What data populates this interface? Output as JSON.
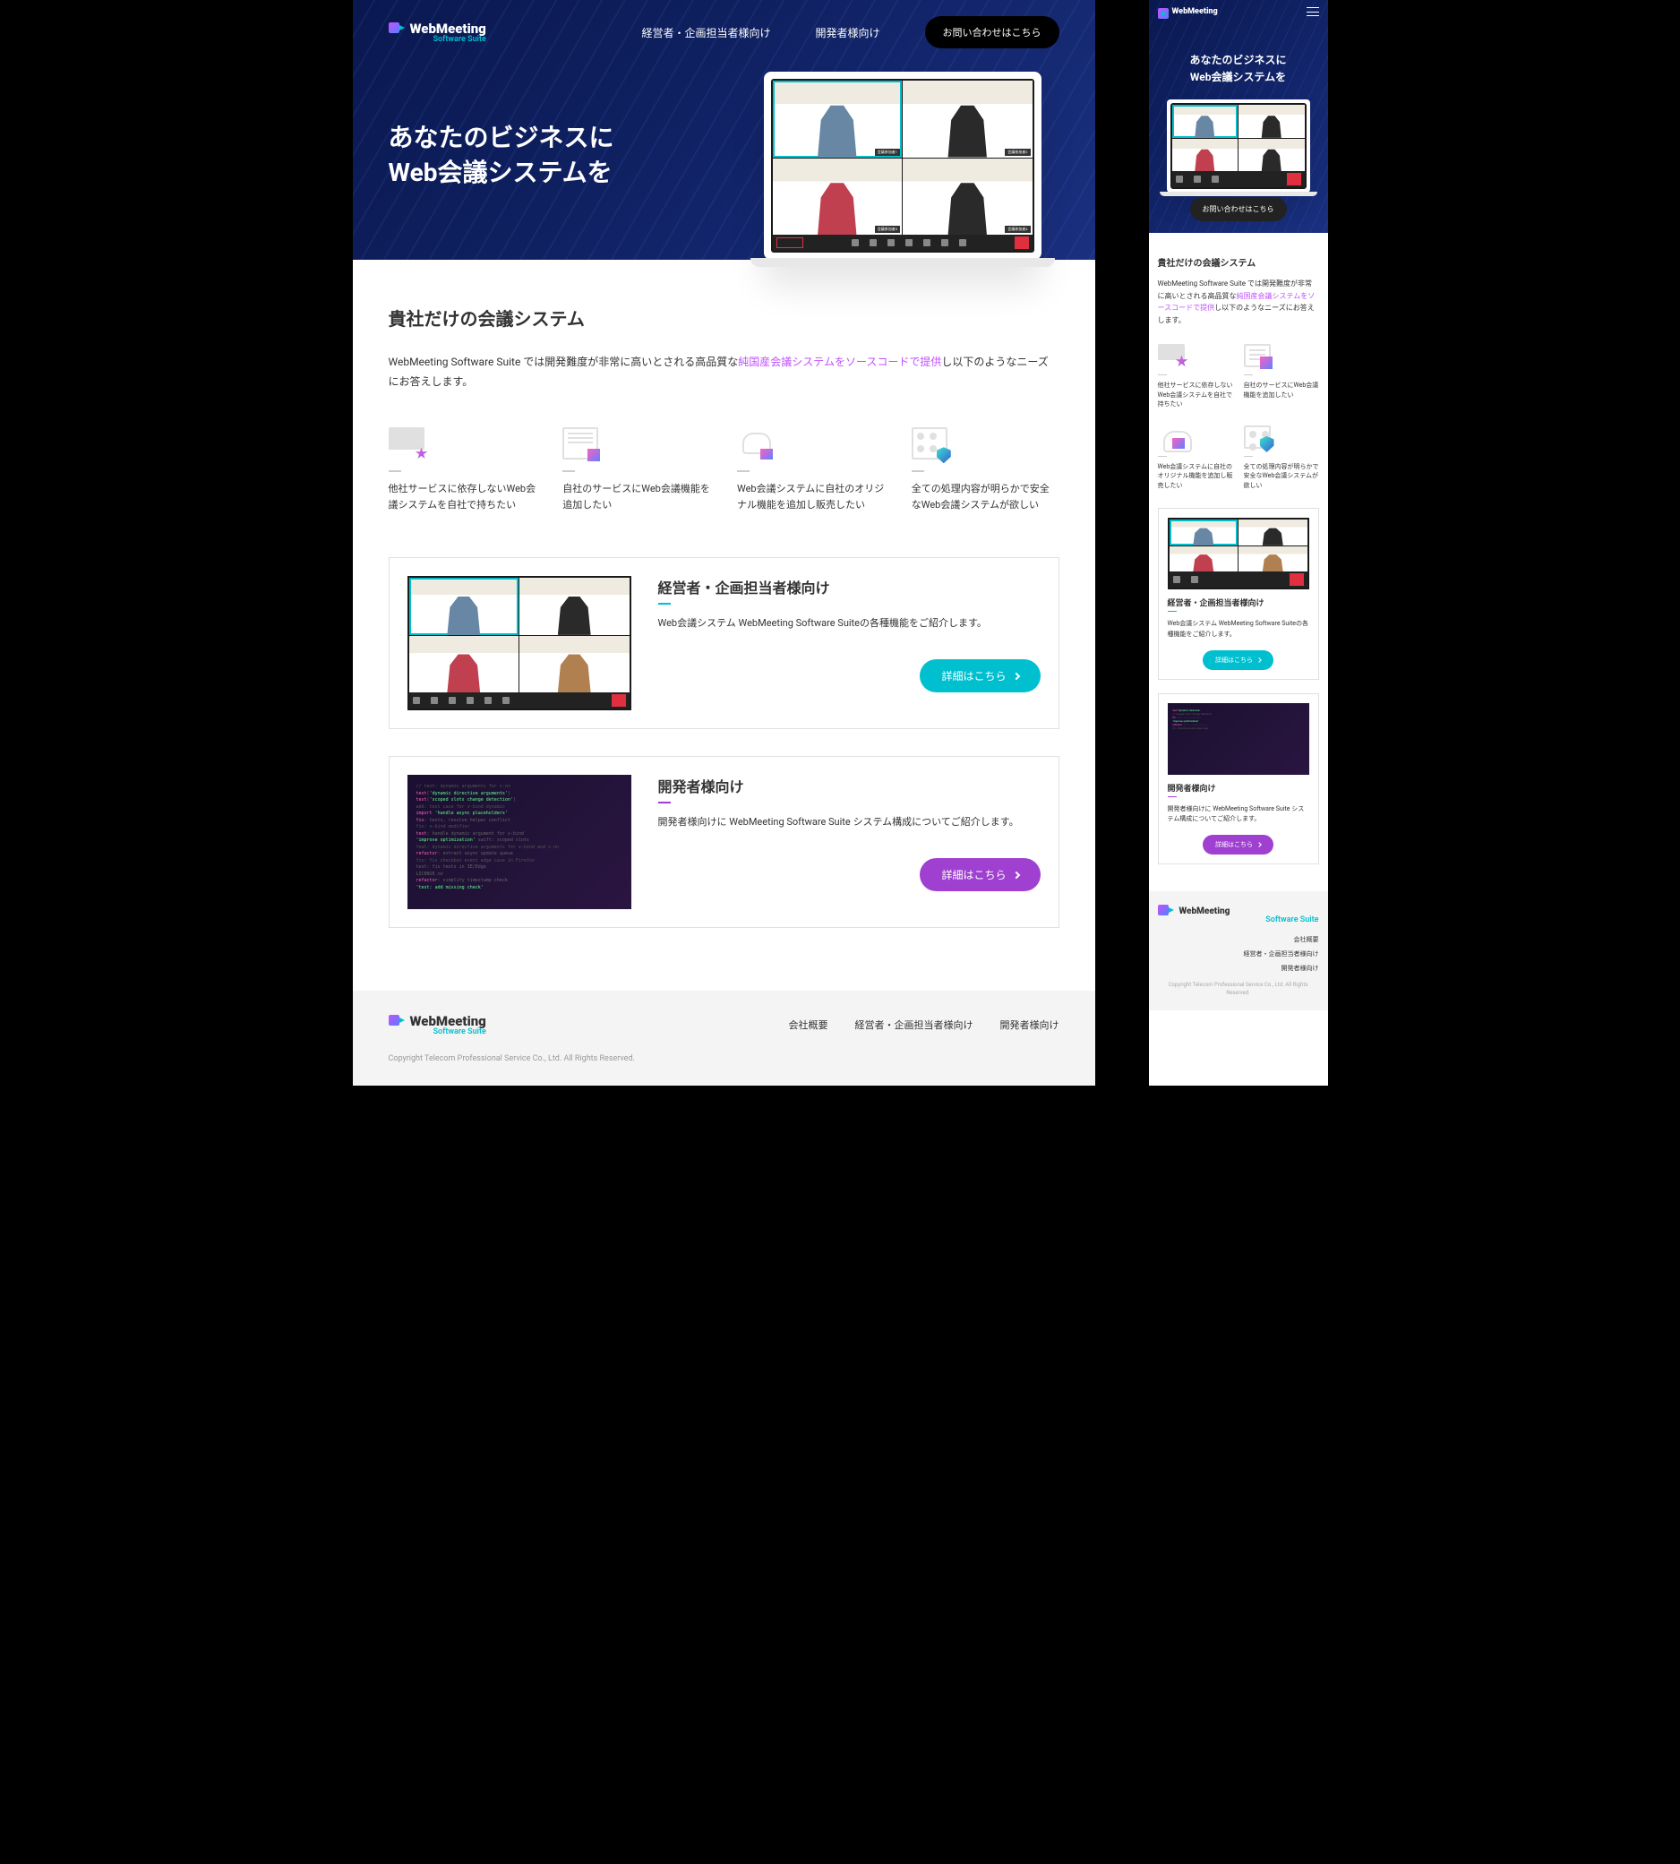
{
  "brand": {
    "name": "WebMeeting",
    "suite": "Software Suite"
  },
  "nav": {
    "link1": "経営者・企画担当者様向け",
    "link2": "開発者様向け",
    "cta": "お問い合わせはこちら"
  },
  "hero": {
    "line1": "あなたのビジネスに",
    "line2": "Web会議システムを"
  },
  "intro": {
    "heading": "貴社だけの会議システム",
    "desc_a": "WebMeeting Software Suite では開発難度が非常に高いとされる高品質な",
    "desc_em": "純国産会議システムをソースコードで提供",
    "desc_b": "し以下のようなニーズにお答えします。"
  },
  "features": [
    {
      "text": "他社サービスに依存しないWeb会議システムを自社で持ちたい"
    },
    {
      "text": "自社のサービスにWeb会議機能を追加したい"
    },
    {
      "text": "Web会議システムに自社のオリジナル機能を追加し販売したい"
    },
    {
      "text": "全ての処理内容が明らかで安全なWeb会議システムが欲しい"
    }
  ],
  "cards": {
    "biz": {
      "title": "経営者・企画担当者様向け",
      "text": "Web会議システム WebMeeting Software Suiteの各種機能をご紹介します。",
      "btn": "詳細はこちら"
    },
    "dev": {
      "title": "開発者様向け",
      "text": "開発者様向けに WebMeeting Software Suite システム構成についてご紹介します。",
      "btn": "詳細はこちら"
    }
  },
  "footer": {
    "link1": "会社概要",
    "link2": "経営者・企画担当者様向け",
    "link3": "開発者様向け",
    "copy": "Copyright Telecom Professional Service Co., Ltd. All Rights Reserved."
  }
}
